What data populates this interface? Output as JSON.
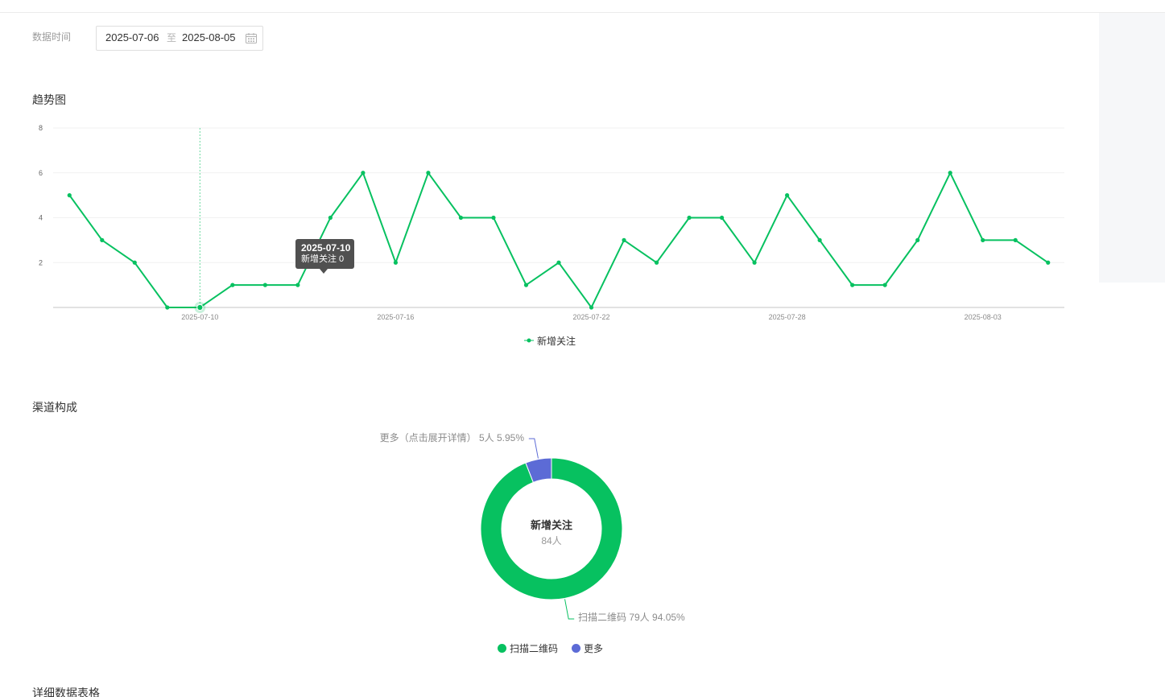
{
  "filter": {
    "label": "数据时间",
    "start_date": "2025-07-06",
    "separator": "至",
    "end_date": "2025-08-05",
    "icon": "calendar-icon"
  },
  "trend": {
    "title": "趋势图",
    "tooltip": {
      "date": "2025-07-10",
      "text": "新增关注 0"
    }
  },
  "channel": {
    "title": "渠道构成"
  },
  "table": {
    "title": "详细数据表格"
  },
  "colors": {
    "primary": "#07c160",
    "secondary": "#5c6bd6",
    "side_panel": "#f6f7f9"
  },
  "chart_data": [
    {
      "type": "line",
      "x": [
        "2025-07-06",
        "2025-07-07",
        "2025-07-08",
        "2025-07-09",
        "2025-07-10",
        "2025-07-11",
        "2025-07-12",
        "2025-07-13",
        "2025-07-14",
        "2025-07-15",
        "2025-07-16",
        "2025-07-17",
        "2025-07-18",
        "2025-07-19",
        "2025-07-20",
        "2025-07-21",
        "2025-07-22",
        "2025-07-23",
        "2025-07-24",
        "2025-07-25",
        "2025-07-26",
        "2025-07-27",
        "2025-07-28",
        "2025-07-29",
        "2025-07-30",
        "2025-07-31",
        "2025-08-01",
        "2025-08-02",
        "2025-08-03",
        "2025-08-04",
        "2025-08-05"
      ],
      "series": [
        {
          "name": "新增关注",
          "values": [
            5,
            3,
            2,
            0,
            0,
            1,
            1,
            1,
            4,
            6,
            2,
            6,
            4,
            4,
            1,
            2,
            0,
            3,
            2,
            4,
            4,
            2,
            5,
            3,
            1,
            1,
            3,
            6,
            3,
            3,
            2
          ]
        }
      ],
      "xticks": [
        "2025-07-10",
        "2025-07-16",
        "2025-07-22",
        "2025-07-28",
        "2025-08-03"
      ],
      "yticks": [
        2,
        4,
        6,
        8
      ],
      "ylim": [
        0,
        8
      ],
      "grid": true,
      "legend": "bottom"
    },
    {
      "type": "pie",
      "donut": true,
      "categories": [
        "扫描二维码",
        "更多"
      ],
      "values": [
        79,
        5
      ],
      "percent": [
        94.05,
        5.95
      ],
      "labels": [
        "扫描二维码 79人 94.05%",
        "更多（点击展开详情） 5人 5.95%"
      ],
      "center_label": "新增关注",
      "center_value": "84人",
      "legend": "bottom"
    }
  ]
}
